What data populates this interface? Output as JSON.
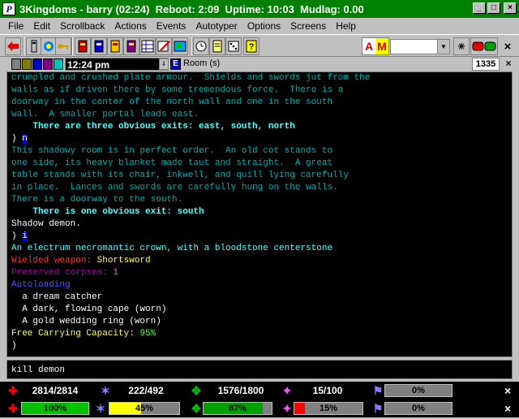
{
  "window": {
    "title": "3Kingdoms - barry (02:24)  Reboot: 2:09  Uptime: 10:03  Mudlag: 0.00",
    "app_icon_glyph": "P",
    "buttons": [
      "_",
      "□",
      "×"
    ]
  },
  "menu": [
    {
      "label": "File"
    },
    {
      "label": "Edit"
    },
    {
      "label": "Scrollback"
    },
    {
      "label": "Actions"
    },
    {
      "label": "Events"
    },
    {
      "label": "Autotyper"
    },
    {
      "label": "Options"
    },
    {
      "label": "Screens"
    },
    {
      "label": "Help"
    }
  ],
  "toolbar": {
    "am_a": "A",
    "am_m": "M",
    "combo_arrow": "▼",
    "star": "✳",
    "close": "×"
  },
  "status": {
    "clock": "12:24 pm",
    "room_label": "Room (s)",
    "counter": "1335",
    "close": "×"
  },
  "terminal": {
    "lines": [
      {
        "text": "crumpled and crushed plate armour.  Shields and swords jut from the",
        "color": "#00aaaa"
      },
      {
        "text": "walls as if driven there by some tremendous force.  There is a",
        "color": "#00aaaa"
      },
      {
        "text": "doorway in the center of the north wall and one in the south",
        "color": "#00aaaa"
      },
      {
        "text": "wall.  A smaller portal leads east.",
        "color": "#00aaaa"
      },
      {
        "text": "    There are three obvious exits: east, south, north",
        "color": "#55ffff",
        "bold": true
      },
      {
        "text": ") n",
        "color": "#ffffff",
        "cursor": true
      },
      {
        "text": "This shadowy room is in perfect order.  An old cot stands to",
        "color": "#00aaaa"
      },
      {
        "text": "one side, its heavy blanket made taut and straight.  A great",
        "color": "#00aaaa"
      },
      {
        "text": "table stands with its chair, inkwell, and quill lying carefully",
        "color": "#00aaaa"
      },
      {
        "text": "in place.  Lances and swords are carefully hung on the walls.",
        "color": "#00aaaa"
      },
      {
        "text": "There is a doorway to the south.",
        "color": "#00aaaa"
      },
      {
        "text": "    There is one obvious exit: south",
        "color": "#55ffff",
        "bold": true
      },
      {
        "text": "Shadow demon.",
        "color": "#ffffff"
      },
      {
        "text": ") i",
        "color": "#ffffff",
        "cursor": true
      },
      {
        "text": "An electrum necromantic crown, with a bloodstone centerstone",
        "color": "#55ffff"
      },
      {
        "parts": [
          {
            "text": "Wielded weapon: ",
            "color": "#ff3030"
          },
          {
            "text": "Shortsword",
            "color": "#ffff55"
          }
        ]
      },
      {
        "parts": [
          {
            "text": "Preserved corpses: ",
            "color": "#aa00aa"
          },
          {
            "text": "1",
            "color": "#ff55ff"
          }
        ]
      },
      {
        "text": "Autoloading",
        "color": "#5555ff"
      },
      {
        "text": "  a dream catcher",
        "color": "#ffffff"
      },
      {
        "text": "  A dark, flowing cape (worn)",
        "color": "#ffffff"
      },
      {
        "text": "  A gold wedding ring (worn)",
        "color": "#ffffff"
      },
      {
        "parts": [
          {
            "text": "Free Carrying Capacity: ",
            "color": "#ffff55"
          },
          {
            "text": "95%",
            "color": "#55ff55"
          }
        ]
      },
      {
        "text": ")",
        "color": "#ffffff"
      }
    ]
  },
  "input": {
    "value": "kill demon"
  },
  "stats_top": {
    "hp": "2814/2814",
    "sp": "222/492",
    "ep": "1576/1800",
    "xp": "15/100",
    "bar_pct": 0,
    "bar_label": "0%"
  },
  "stats_bottom": [
    {
      "label": "100%",
      "pct": 100,
      "color": "#00c000"
    },
    {
      "label": "45%",
      "pct": 45,
      "color": "#ffff00"
    },
    {
      "label": "87%",
      "pct": 87,
      "color": "#00a000"
    },
    {
      "label": "15%",
      "pct": 15,
      "color": "#ff0000"
    },
    {
      "label": "0%",
      "pct": 0,
      "color": "#808080"
    }
  ],
  "colors": {
    "titlebar": "#008000",
    "terminal_bg": "#000000"
  }
}
